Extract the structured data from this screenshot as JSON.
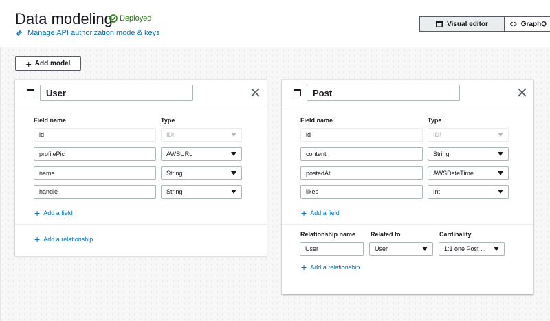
{
  "header": {
    "title": "Data modeling",
    "status": "Deployed",
    "manage_link": "Manage API authorization mode & keys",
    "visual_editor": "Visual editor",
    "graphql_tab": "GraphQ"
  },
  "toolbar": {
    "add_model": "Add model"
  },
  "labels": {
    "field_name": "Field name",
    "type": "Type",
    "add_field": "Add a field",
    "add_relationship": "Add a relationship",
    "relationship_name": "Relationship name",
    "related_to": "Related to",
    "cardinality": "Cardinality"
  },
  "models": [
    {
      "name": "User",
      "fields": [
        {
          "name": "id",
          "type": "ID!"
        },
        {
          "name": "profilePic",
          "type": "AWSURL"
        },
        {
          "name": "name",
          "type": "String"
        },
        {
          "name": "handle",
          "type": "String"
        }
      ]
    },
    {
      "name": "Post",
      "fields": [
        {
          "name": "id",
          "type": "ID!"
        },
        {
          "name": "content",
          "type": "String"
        },
        {
          "name": "postedAt",
          "type": "AWSDateTime"
        },
        {
          "name": "likes",
          "type": "Int"
        }
      ],
      "relationship": {
        "name": "User",
        "related_to": "User",
        "cardinality": "1:1 one Post ..."
      }
    }
  ],
  "icons": {
    "status": "check-circle-icon",
    "link": "link-icon",
    "visual_editor": "window-icon",
    "graphql": "code-icon",
    "model": "window-icon",
    "close": "close-icon",
    "add": "plus-icon",
    "dropdown": "caret-down-icon"
  },
  "colors": {
    "accent": "#0073bb",
    "success": "#1d8102",
    "text": "#16191f",
    "border": "#aab7b8"
  }
}
